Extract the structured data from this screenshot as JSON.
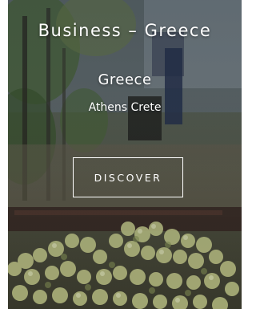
{
  "hero": {
    "title": "Business – Greece",
    "country": "Greece",
    "cities": "Athens Crete",
    "cta_label": "DISCOVER"
  }
}
